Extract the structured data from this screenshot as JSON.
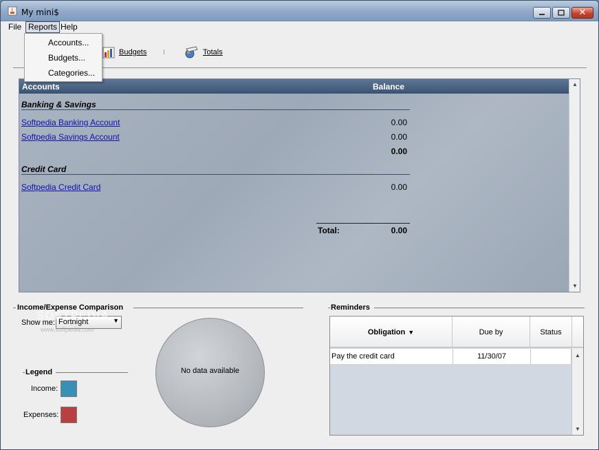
{
  "window": {
    "title": "My mini$"
  },
  "menubar": {
    "items": [
      "File",
      "Reports",
      "Help"
    ]
  },
  "reports_menu": {
    "items": [
      "Accounts...",
      "Budgets...",
      "Categories..."
    ]
  },
  "toolbar": {
    "budgets_label": "Budgets",
    "totals_label": "Totals"
  },
  "accounts": {
    "header_accounts": "Accounts",
    "header_balance": "Balance",
    "groups": [
      {
        "name": "Banking & Savings",
        "accounts": [
          {
            "name": "Softpedia Banking Account",
            "balance": "0.00"
          },
          {
            "name": "Softpedia Savings Account",
            "balance": "0.00"
          }
        ],
        "subtotal": "0.00"
      },
      {
        "name": "Credit Card",
        "accounts": [
          {
            "name": "Softpedia Credit Card",
            "balance": "0.00"
          }
        ]
      }
    ],
    "total_label": "Total:",
    "total_value": "0.00"
  },
  "comparison": {
    "title": "Income/Expense Comparison",
    "show_me_label": "Show me:",
    "show_me_value": "Fortnight",
    "legend_title": "Legend",
    "legend_income": "Income:",
    "legend_expenses": "Expenses:",
    "no_data": "No data available",
    "colors": {
      "income": "#3a8fb5",
      "expenses": "#b84040"
    }
  },
  "reminders": {
    "title": "Reminders",
    "columns": [
      "Obligation",
      "Due by",
      "Status"
    ],
    "rows": [
      {
        "obligation": "Pay the credit card",
        "due_by": "11/30/07",
        "status": ""
      }
    ]
  },
  "watermark": {
    "text": "SOFTPEDIA",
    "sub": "www.softpedia.com"
  }
}
